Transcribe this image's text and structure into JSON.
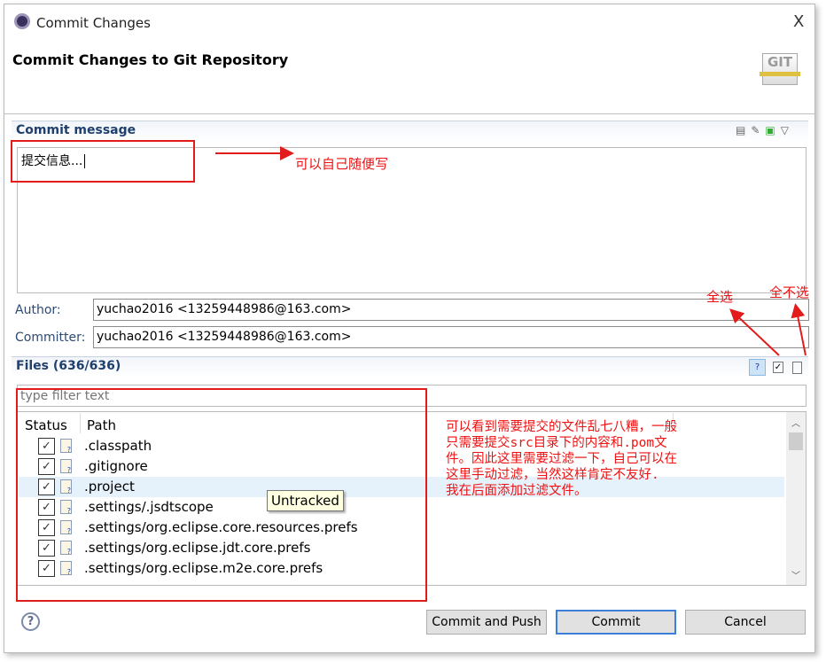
{
  "window": {
    "title": "Commit Changes",
    "close": "X"
  },
  "header": {
    "title": "Commit Changes to Git Repository",
    "logo": "GIT"
  },
  "commit_message": {
    "section_label": "Commit message",
    "value": "提交信息..."
  },
  "author": {
    "label": "Author:",
    "value": "yuchao2016 <13259448986@163.com>"
  },
  "committer": {
    "label": "Committer:",
    "value": "yuchao2016 <13259448986@163.com>"
  },
  "files": {
    "section_label": "Files (636/636)",
    "filter_placeholder": "type filter text",
    "columns": [
      "Status",
      "Path"
    ],
    "rows": [
      {
        "path": ".classpath",
        "icon": "untracked-file-icon",
        "checked": true
      },
      {
        "path": ".gitignore",
        "icon": "untracked-file-icon",
        "checked": true
      },
      {
        "path": ".project",
        "icon": "untracked-file-icon",
        "checked": true
      },
      {
        "path": ".settings/.jsdtscope",
        "icon": "untracked-file-icon",
        "checked": true
      },
      {
        "path": ".settings/org.eclipse.core.resources.prefs",
        "icon": "untracked-file-icon",
        "checked": true
      },
      {
        "path": ".settings/org.eclipse.jdt.core.prefs",
        "icon": "untracked-file-icon",
        "checked": true
      },
      {
        "path": ".settings/org.eclipse.m2e.core.prefs",
        "icon": "untracked-file-icon",
        "checked": true
      }
    ],
    "tooltip": "Untracked"
  },
  "buttons": {
    "commit_and_push": "Commit and Push",
    "commit": "Commit",
    "cancel": "Cancel"
  },
  "annotations": {
    "message_note": "可以自己随便写",
    "select_all": "全选",
    "deselect_all": "全不选",
    "files_note": "可以看到需要提交的文件乱七八糟，一般只需要提交src目录下的内容和.pom文件。因此这里需要过滤一下，自己可以在这里手动过滤，当然这样肯定不友好. 我在后面添加过滤文件。"
  },
  "colors": {
    "annotation": "#e21b1b",
    "section_title": "#1f3f6e",
    "primary_border": "#3c7fd8"
  }
}
